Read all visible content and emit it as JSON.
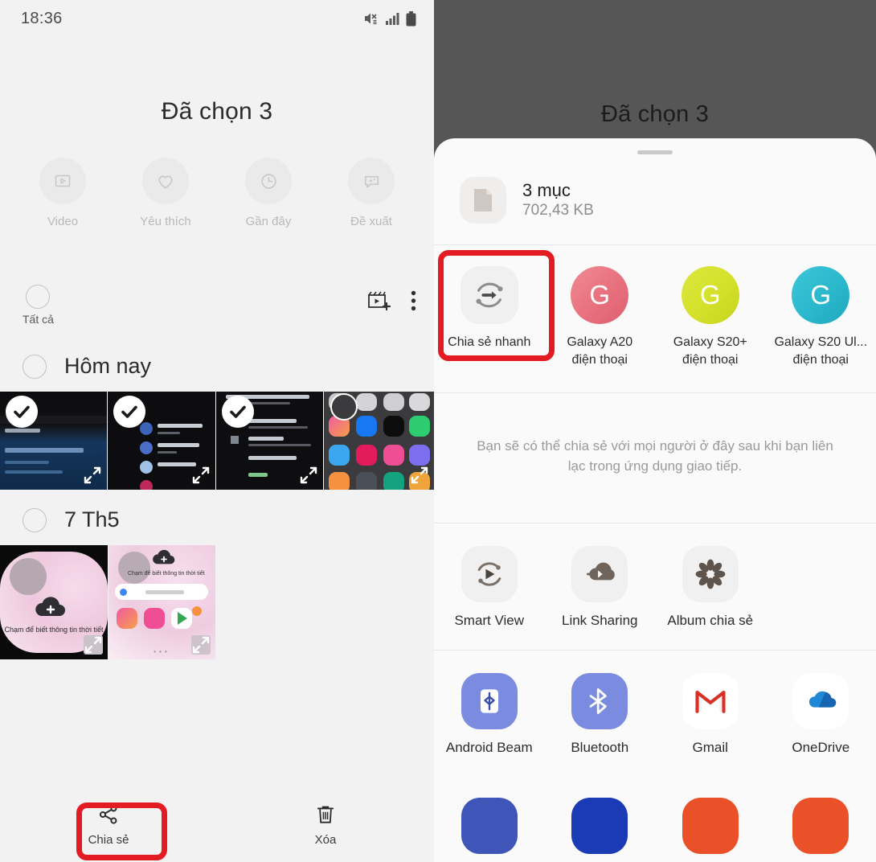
{
  "left": {
    "status": {
      "time": "18:36",
      "icons": [
        "mute-icon",
        "signal-icon",
        "battery-icon"
      ]
    },
    "title": "Đã chọn 3",
    "quick_filters": [
      {
        "label": "Video",
        "icon": "video-icon"
      },
      {
        "label": "Yêu thích",
        "icon": "heart-icon"
      },
      {
        "label": "Gần đây",
        "icon": "clock-icon"
      },
      {
        "label": "Đề xuất",
        "icon": "suggestion-icon"
      }
    ],
    "select_all_label": "Tất cả",
    "toolbar_icons": [
      {
        "name": "create-movie-icon"
      },
      {
        "name": "more-options-icon"
      }
    ],
    "groups": [
      {
        "label": "Hôm nay",
        "count": 4
      },
      {
        "label": "7 Th5",
        "count": 2
      }
    ],
    "bottom_actions": [
      {
        "label": "Chia sẻ",
        "icon": "share-icon",
        "highlighted": true
      },
      {
        "label": "Xóa",
        "icon": "trash-icon",
        "highlighted": false
      }
    ]
  },
  "right": {
    "title": "Đã chọn 3",
    "file": {
      "count_label": "3 mục",
      "size_label": "702,43 KB",
      "icon": "document-icon"
    },
    "devices": [
      {
        "label": "Chia sẻ nhanh",
        "type": "quickshare",
        "icon": "quick-share-icon",
        "highlighted": true
      },
      {
        "label": "Galaxy A20\nđiện thoại",
        "type": "contact",
        "initial": "G",
        "color": "#e8717e"
      },
      {
        "label": "Galaxy S20+\nđiện thoại",
        "type": "contact",
        "initial": "G",
        "color": "#d4e029"
      },
      {
        "label": "Galaxy S20 Ul...\nđiện thoại",
        "type": "contact",
        "initial": "G",
        "color": "#2bb8cc"
      }
    ],
    "hint": "Bạn sẽ có thể chia sẻ với mọi người ở đây sau khi bạn liên lạc trong ứng dụng giao tiếp.",
    "features": [
      {
        "label": "Smart View",
        "icon": "smart-view-icon"
      },
      {
        "label": "Link Sharing",
        "icon": "link-sharing-icon"
      },
      {
        "label": "Album chia sẻ",
        "icon": "shared-album-icon"
      }
    ],
    "apps": [
      {
        "label": "Android Beam",
        "icon": "android-beam-icon",
        "color": "#7b8ce0"
      },
      {
        "label": "Bluetooth",
        "icon": "bluetooth-icon",
        "color": "#7b8ce0"
      },
      {
        "label": "Gmail",
        "icon": "gmail-icon",
        "color": "#ffffff"
      },
      {
        "label": "OneDrive",
        "icon": "onedrive-icon",
        "color": "#ffffff"
      }
    ],
    "apps_partial": [
      {
        "color": "#4055b8"
      },
      {
        "color": "#1b3bb5"
      },
      {
        "color": "#ea5128"
      },
      {
        "color": "#ea5128"
      }
    ]
  },
  "colors": {
    "highlight": "#e31b22",
    "panel_bg": "#f2f2f2",
    "scrim": "#565656",
    "sheet_bg": "#fafafa"
  }
}
